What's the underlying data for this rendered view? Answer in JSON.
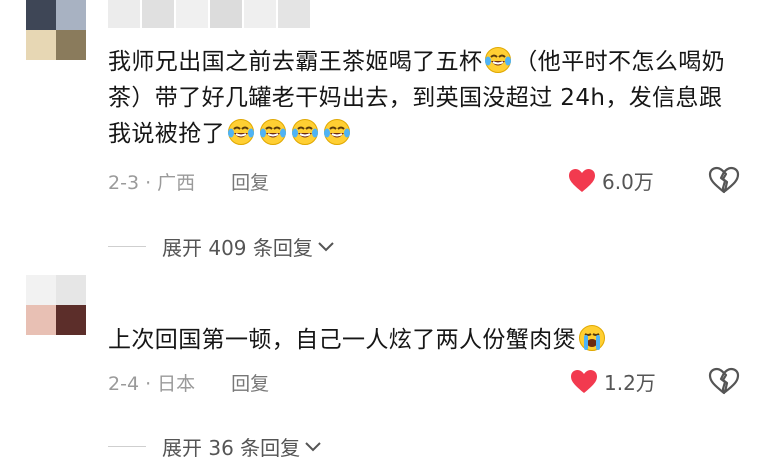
{
  "comments": [
    {
      "avatar_colors": [
        "#3e4656",
        "#a8b2c2",
        "#e7d7b4",
        "#8a7b5c"
      ],
      "text_parts": [
        "我师兄出国之前去霸王茶姬喝了五杯",
        "（他平时不怎么喝奶茶）带了好几罐老干妈出去，到英国没超过 24h，发信息跟我说被抢了"
      ],
      "emoji": "crying-laughing-emoji",
      "date_location": "2-3 · 广西",
      "reply_label": "回复",
      "like_count": "6.0万",
      "expand_label": "展开 409 条回复"
    },
    {
      "avatar_colors": [
        "#f2f2f2",
        "#e6e6e6",
        "#e8c0b4",
        "#5c2e2a"
      ],
      "text": "上次回国第一顿，自己一人炫了两人份蟹肉煲",
      "emoji": "loudly-crying-emoji",
      "date_location": "2-4 · 日本",
      "reply_label": "回复",
      "like_count": "1.2万",
      "expand_label": "展开 36 条回复"
    }
  ],
  "colors": {
    "heart": "#f23a4f",
    "text": "#161616",
    "meta": "#9a9a9a"
  }
}
